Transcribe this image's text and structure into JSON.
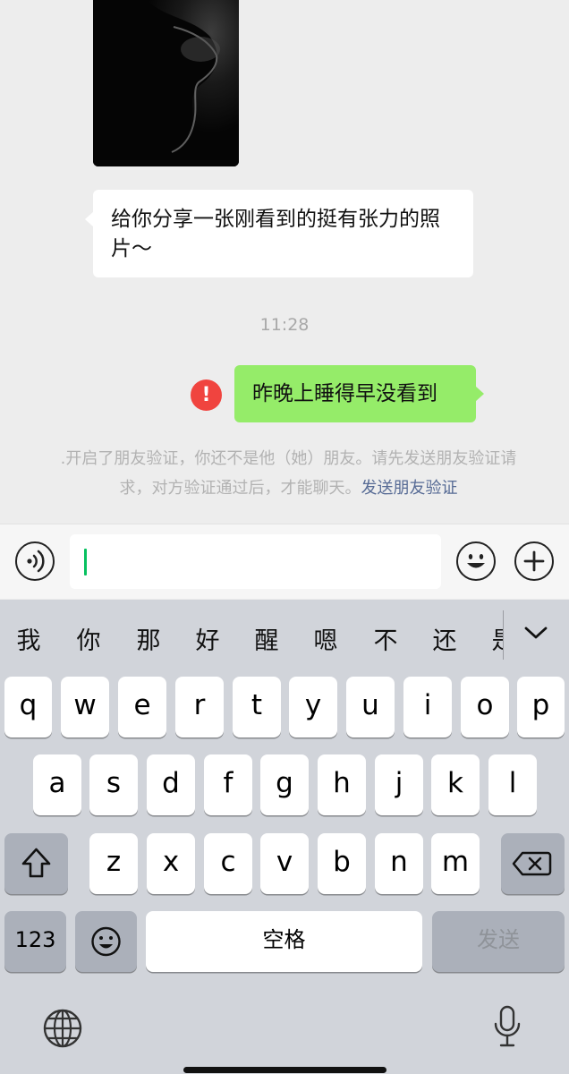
{
  "chat": {
    "incoming_message": "给你分享一张刚看到的挺有张力的照片～",
    "timestamp": "11:28",
    "outgoing_message": "昨晚上睡得早没看到",
    "error_mark": "!",
    "system_notice": ".开启了朋友验证，你还不是他（她）朋友。请先发送朋友验证请求，对方验证通过后，才能聊天。",
    "system_notice_link": "发送朋友验证"
  },
  "input_bar": {
    "text_value": "",
    "icons": [
      "voice-icon",
      "emoji-icon",
      "plus-icon"
    ]
  },
  "keyboard": {
    "candidates": [
      "我",
      "你",
      "那",
      "好",
      "醒",
      "嗯",
      "不",
      "还",
      "是"
    ],
    "row1": [
      "q",
      "w",
      "e",
      "r",
      "t",
      "y",
      "u",
      "i",
      "o",
      "p"
    ],
    "row2": [
      "a",
      "s",
      "d",
      "f",
      "g",
      "h",
      "j",
      "k",
      "l"
    ],
    "row3": [
      "z",
      "x",
      "c",
      "v",
      "b",
      "n",
      "m"
    ],
    "numbers_key": "123",
    "space_key": "空格",
    "send_key": "发送",
    "icons": [
      "shift-icon",
      "delete-icon",
      "emoji-key-icon",
      "globe-icon",
      "mic-icon",
      "chevron-down-icon"
    ]
  },
  "colors": {
    "outgoing_bubble": "#95ec69",
    "error": "#f0443f",
    "link": "#576b95",
    "caret": "#07c160"
  }
}
